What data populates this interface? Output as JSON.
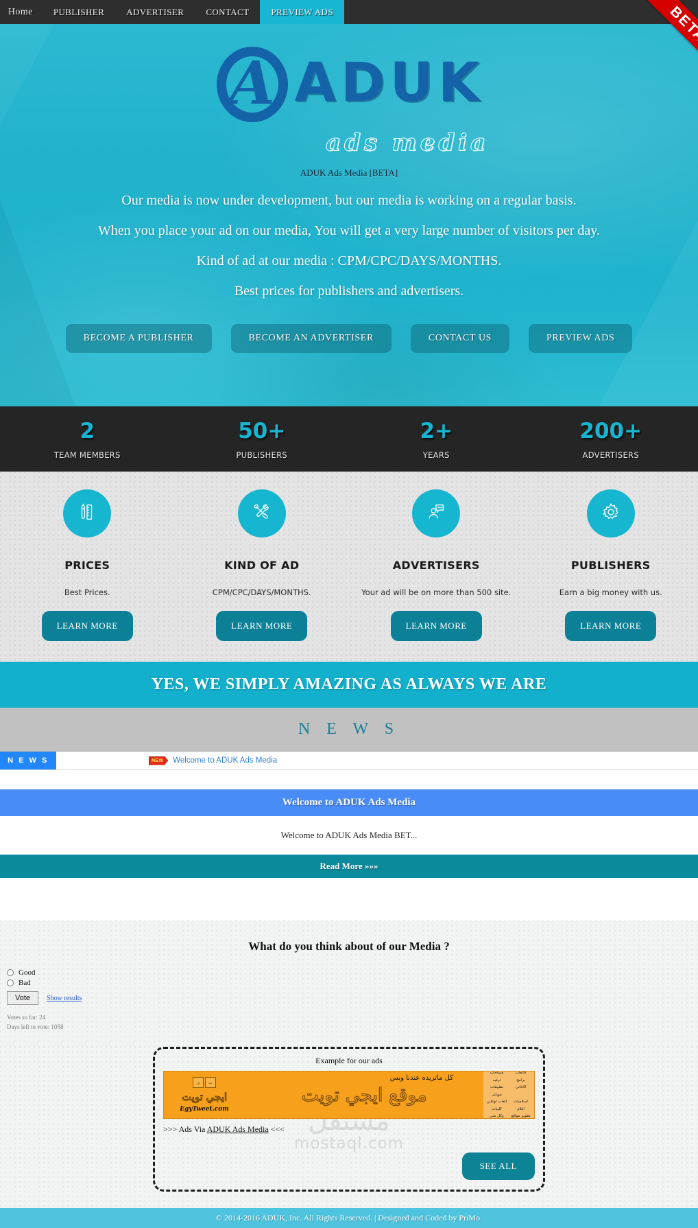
{
  "nav": {
    "items": [
      {
        "label": "Home",
        "active": false
      },
      {
        "label": "PUBLISHER",
        "active": false
      },
      {
        "label": "ADVERTISER",
        "active": false
      },
      {
        "label": "CONTACT",
        "active": false
      },
      {
        "label": "PREVIEW ADS",
        "active": true
      }
    ],
    "ribbon": "BETA"
  },
  "hero": {
    "logo": {
      "mark": "A",
      "word": "ADUK",
      "tagline": "ads media"
    },
    "subtitle": "ADUK Ads Media [BETA]",
    "lines": [
      "Our media is now under development, but our media is working on a regular basis.",
      "When you place your ad on our media, You will get a very large number of visitors per day.",
      "Kind of ad at our media : CPM/CPC/DAYS/MONTHS.",
      "Best prices for publishers and advertisers."
    ],
    "buttons": [
      "BECOME A PUBLISHER",
      "BECOME AN ADVERTISER",
      "CONTACT US",
      "PREVIEW ADS"
    ]
  },
  "stats": [
    {
      "value": "2",
      "label": "TEAM MEMBERS"
    },
    {
      "value": "50+",
      "label": "PUBLISHERS"
    },
    {
      "value": "2+",
      "label": "YEARS"
    },
    {
      "value": "200+",
      "label": "ADVERTISERS"
    }
  ],
  "features": [
    {
      "icon": "pencil-ruler-icon",
      "title": "PRICES",
      "desc": "Best Prices.",
      "button": "LEARN MORE"
    },
    {
      "icon": "tools-icon",
      "title": "KIND OF AD",
      "desc": "CPM/CPC/DAYS/MONTHS.",
      "button": "LEARN MORE"
    },
    {
      "icon": "support-chat-icon",
      "title": "ADVERTISERS",
      "desc": "Your ad will be on more than 500 site.",
      "button": "LEARN MORE"
    },
    {
      "icon": "gear-icon",
      "title": "PUBLISHERS",
      "desc": "Earn a big money with us.",
      "button": "LEARN MORE"
    }
  ],
  "amazing_bar": "YES, WE SIMPLY AMAZING AS ALWAYS WE ARE",
  "news": {
    "heading": "N E W S",
    "ticker": {
      "label": "N E W S",
      "badge": "NEW",
      "item": "Welcome to ADUK Ads Media"
    },
    "article": {
      "title": "Welcome to ADUK Ads Media",
      "excerpt": "Welcome to ADUK Ads Media BET...",
      "read_more": "Read More »»»"
    }
  },
  "poll": {
    "question": "What do you think about of our Media ?",
    "options": [
      "Good",
      "Bad"
    ],
    "vote_button": "Vote",
    "results_link": "Show results",
    "votes_so_far": "Votes so far: 24",
    "days_left": "Days left to vote: 1058"
  },
  "ads": {
    "title": "Example for our ads",
    "banner": {
      "menu": [
        "الالعاب",
        "مساحات",
        "برامج",
        "ترفيه",
        "الاغاني",
        "تطبيقات موبايل",
        "اسلاميات",
        "العاب اونلاين",
        "افلام",
        "كليبات",
        "تطوير مواقع",
        "وكل شي"
      ],
      "headline": "كل ماتريده عندنا وبس",
      "big_text": "موقع ايجي تويت",
      "brand": "ايجي تويت",
      "site": "EgyTweet.com"
    },
    "via_prefix": ">>> Ads Via ",
    "via_link": "ADUK Ads Media",
    "via_suffix": " <<<",
    "see_all": "SEE ALL",
    "watermark_ar": "مستقل",
    "watermark_en": "mostaql.com"
  },
  "footer": "© 2014-2016 ADUK, Inc. All Rights Reserved. | Designed and Coded by PriMo.",
  "colors": {
    "accent": "#16b5d0",
    "dark": "#252525",
    "teal_button": "#0b8096",
    "ribbon_red": "#d60000",
    "link_blue": "#2f7fd6"
  }
}
